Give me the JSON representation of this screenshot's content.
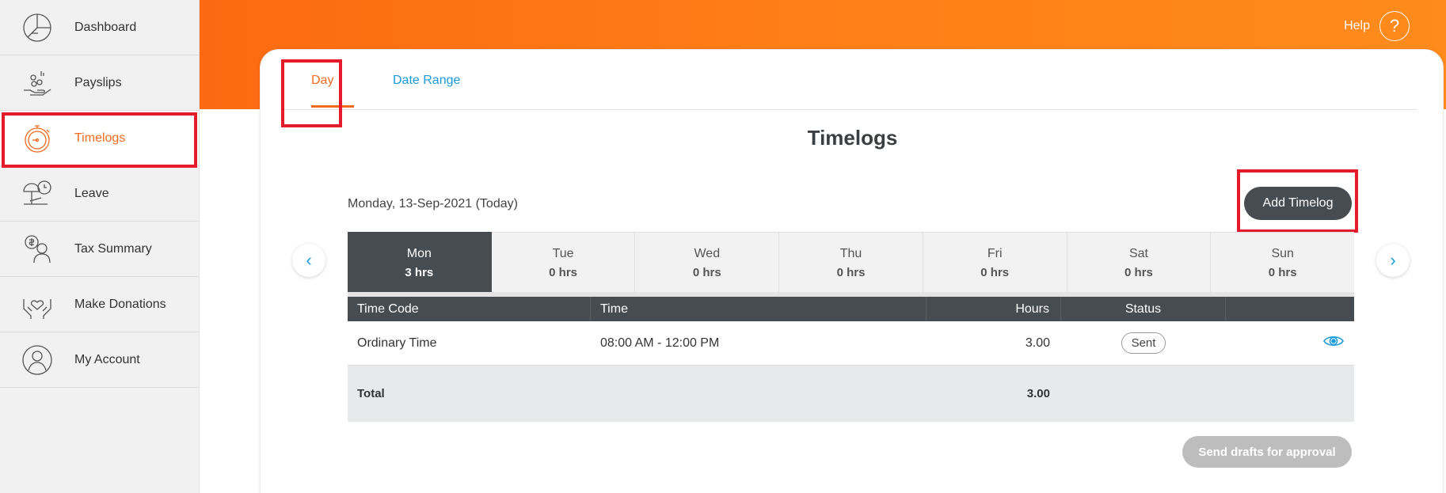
{
  "sidebar": {
    "items": [
      {
        "label": "Dashboard",
        "icon": "dashboard-pie-icon"
      },
      {
        "label": "Payslips",
        "icon": "payslips-hand-coins-icon"
      },
      {
        "label": "Timelogs",
        "icon": "stopwatch-icon"
      },
      {
        "label": "Leave",
        "icon": "leave-umbrella-icon"
      },
      {
        "label": "Tax Summary",
        "icon": "tax-person-icon"
      },
      {
        "label": "Make Donations",
        "icon": "donation-hands-heart-icon"
      },
      {
        "label": "My Account",
        "icon": "account-person-icon"
      }
    ],
    "active": "Timelogs"
  },
  "header": {
    "help_label": "Help",
    "help_icon": "question-circle-icon"
  },
  "tabs": {
    "day": "Day",
    "date_range": "Date Range"
  },
  "main": {
    "title": "Timelogs",
    "date_label": "Monday, 13-Sep-2021 (Today)",
    "add_button": "Add Timelog",
    "prev_arrow": "‹",
    "next_arrow": "›",
    "send_button": "Send drafts for approval"
  },
  "days": [
    {
      "name": "Mon",
      "hours": "3 hrs"
    },
    {
      "name": "Tue",
      "hours": "0 hrs"
    },
    {
      "name": "Wed",
      "hours": "0 hrs"
    },
    {
      "name": "Thu",
      "hours": "0 hrs"
    },
    {
      "name": "Fri",
      "hours": "0 hrs"
    },
    {
      "name": "Sat",
      "hours": "0 hrs"
    },
    {
      "name": "Sun",
      "hours": "0 hrs"
    }
  ],
  "table": {
    "headers": {
      "time_code": "Time Code",
      "time": "Time",
      "hours": "Hours",
      "status": "Status"
    },
    "rows": [
      {
        "time_code": "Ordinary Time",
        "time": "08:00 AM - 12:00 PM",
        "hours": "3.00",
        "status": "Sent",
        "action_icon": "eye-icon"
      }
    ],
    "total_label": "Total",
    "total_hours": "3.00"
  },
  "colors": {
    "accent": "#f26b1d",
    "link": "#1a9bd7",
    "dark": "#474c50",
    "highlight": "#e31b2b"
  }
}
